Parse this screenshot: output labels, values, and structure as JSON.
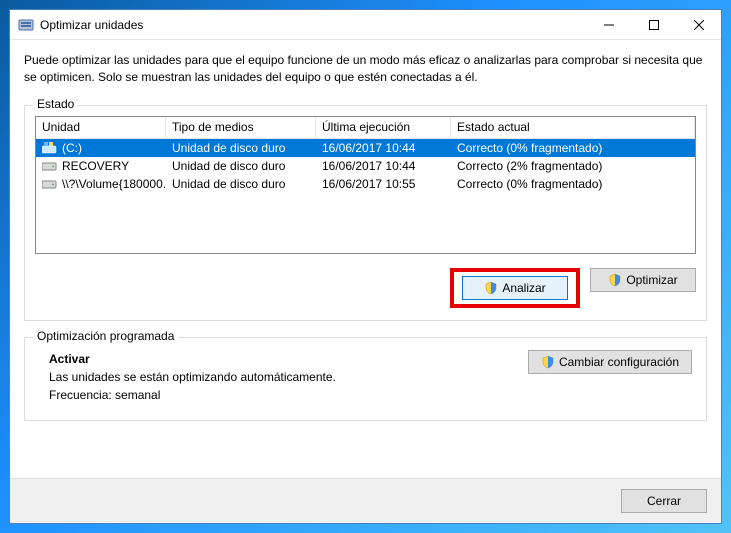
{
  "window": {
    "title": "Optimizar unidades"
  },
  "intro": "Puede optimizar las unidades para que el equipo funcione de un modo más eficaz o analizarlas para comprobar si necesita que se optimicen. Solo se muestran las unidades del equipo o que estén conectadas a él.",
  "status": {
    "legend": "Estado",
    "columns": {
      "unit": "Unidad",
      "media": "Tipo de medios",
      "last": "Última ejecución",
      "state": "Estado actual"
    },
    "rows": [
      {
        "unit": "(C:)",
        "media": "Unidad de disco duro",
        "last": "16/06/2017 10:44",
        "state": "Correcto (0% fragmentado)",
        "icon": "sys"
      },
      {
        "unit": "RECOVERY",
        "media": "Unidad de disco duro",
        "last": "16/06/2017 10:44",
        "state": "Correcto (2% fragmentado)",
        "icon": "hdd"
      },
      {
        "unit": "\\\\?\\Volume{180000...",
        "media": "Unidad de disco duro",
        "last": "16/06/2017 10:55",
        "state": "Correcto (0% fragmentado)",
        "icon": "hdd"
      }
    ],
    "analyze": "Analizar",
    "optimize": "Optimizar"
  },
  "schedule": {
    "legend": "Optimización programada",
    "activate": "Activar",
    "line1": "Las unidades se están optimizando automáticamente.",
    "line2": "Frecuencia: semanal",
    "change": "Cambiar configuración"
  },
  "footer": {
    "close": "Cerrar"
  }
}
